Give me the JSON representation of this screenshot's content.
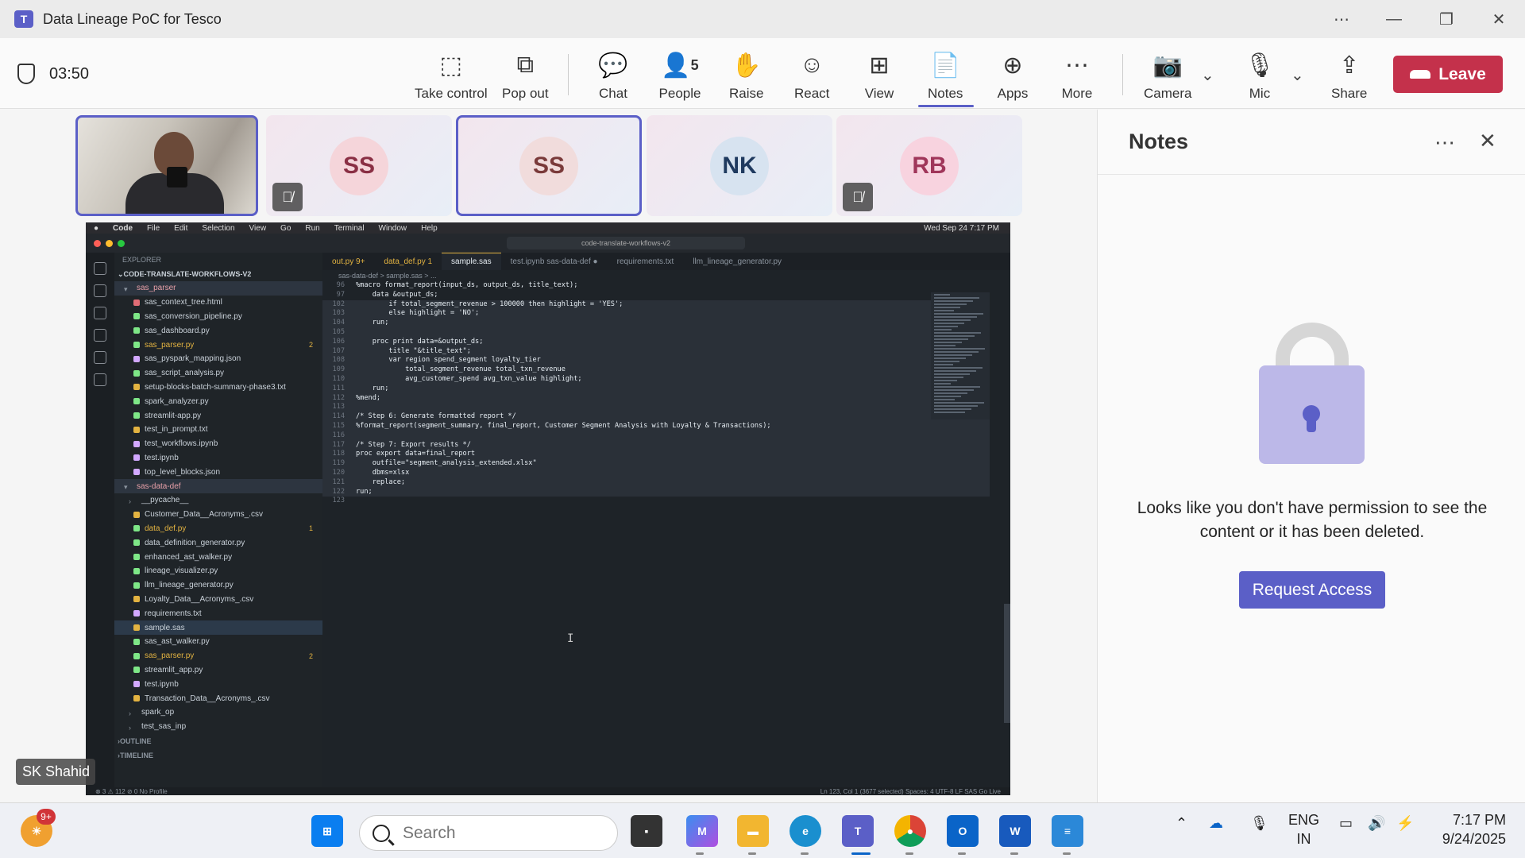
{
  "window": {
    "title": "Data Lineage PoC for Tesco",
    "app_icon": "teams-icon"
  },
  "meeting": {
    "timer": "03:50",
    "toolbar": [
      {
        "label": "Take control",
        "icon": "take-control-icon"
      },
      {
        "label": "Pop out",
        "icon": "pop-out-icon"
      },
      {
        "label": "Chat",
        "icon": "chat-icon"
      },
      {
        "label": "People",
        "icon": "people-icon",
        "count": "5"
      },
      {
        "label": "Raise",
        "icon": "raise-hand-icon"
      },
      {
        "label": "React",
        "icon": "react-icon"
      },
      {
        "label": "View",
        "icon": "view-icon"
      },
      {
        "label": "Notes",
        "icon": "notes-icon",
        "active": true
      },
      {
        "label": "Apps",
        "icon": "apps-icon"
      },
      {
        "label": "More",
        "icon": "more-icon"
      },
      {
        "label": "Camera",
        "icon": "camera-off-icon"
      },
      {
        "label": "Mic",
        "icon": "mic-off-icon"
      },
      {
        "label": "Share",
        "icon": "share-icon"
      }
    ],
    "leave_label": "Leave",
    "participants": [
      {
        "type": "video",
        "active": true
      },
      {
        "initials": "SS",
        "muted": true,
        "color": "#f5d5da",
        "text": "#8a2f44"
      },
      {
        "initials": "SS",
        "muted": false,
        "active": true,
        "color": "#f1dcdc",
        "text": "#7a3a3a"
      },
      {
        "initials": "NK",
        "muted": false,
        "color": "#d7e3f0",
        "text": "#1f3a5f"
      },
      {
        "initials": "RB",
        "muted": true,
        "color": "#f8d3df",
        "text": "#a0365a"
      }
    ],
    "presenter_name": "SK Shahid"
  },
  "screen": {
    "menubar": {
      "items": [
        "Code",
        "File",
        "Edit",
        "Selection",
        "View",
        "Go",
        "Run",
        "Terminal",
        "Window",
        "Help"
      ],
      "clock": "Wed Sep 24  7:17 PM"
    },
    "search": "code-translate-workflows-v2",
    "explorer": {
      "header": "EXPLORER",
      "root": "CODE-TRANSLATE-WORKFLOWS-V2",
      "files": [
        {
          "name": "sas_parser",
          "kind": "folder-open",
          "color": "#e8a0a8"
        },
        {
          "name": "sas_context_tree.html",
          "color": "#e06c75"
        },
        {
          "name": "sas_conversion_pipeline.py",
          "color": "#7ee787"
        },
        {
          "name": "sas_dashboard.py",
          "color": "#7ee787"
        },
        {
          "name": "sas_parser.py",
          "color": "#7ee787",
          "mod": true,
          "badge": "2"
        },
        {
          "name": "sas_pyspark_mapping.json",
          "color": "#d2a8ff"
        },
        {
          "name": "sas_script_analysis.py",
          "color": "#7ee787"
        },
        {
          "name": "setup-blocks-batch-summary-phase3.txt",
          "color": "#e3b341"
        },
        {
          "name": "spark_analyzer.py",
          "color": "#7ee787"
        },
        {
          "name": "streamlit-app.py",
          "color": "#7ee787"
        },
        {
          "name": "test_in_prompt.txt",
          "color": "#e3b341"
        },
        {
          "name": "test_workflows.ipynb",
          "color": "#d2a8ff"
        },
        {
          "name": "test.ipynb",
          "color": "#d2a8ff"
        },
        {
          "name": "top_level_blocks.json",
          "color": "#d2a8ff"
        },
        {
          "name": "sas-data-def",
          "kind": "folder-open",
          "color": "#e8a0a8"
        },
        {
          "name": "__pycache__",
          "kind": "subfolder",
          "color": "#8b949e"
        },
        {
          "name": "Customer_Data__Acronyms_.csv",
          "color": "#e3b341"
        },
        {
          "name": "data_def.py",
          "color": "#7ee787",
          "mod": true,
          "badge": "1"
        },
        {
          "name": "data_definition_generator.py",
          "color": "#7ee787"
        },
        {
          "name": "enhanced_ast_walker.py",
          "color": "#7ee787"
        },
        {
          "name": "lineage_visualizer.py",
          "color": "#7ee787"
        },
        {
          "name": "llm_lineage_generator.py",
          "color": "#7ee787"
        },
        {
          "name": "Loyalty_Data__Acronyms_.csv",
          "color": "#e3b341"
        },
        {
          "name": "requirements.txt",
          "color": "#d2a8ff"
        },
        {
          "name": "sample.sas",
          "color": "#e3b341",
          "sel": true
        },
        {
          "name": "sas_ast_walker.py",
          "color": "#7ee787"
        },
        {
          "name": "sas_parser.py",
          "color": "#7ee787",
          "mod": true,
          "badge": "2"
        },
        {
          "name": "streamlit_app.py",
          "color": "#7ee787"
        },
        {
          "name": "test.ipynb",
          "color": "#d2a8ff"
        },
        {
          "name": "Transaction_Data__Acronyms_.csv",
          "color": "#e3b341"
        },
        {
          "name": "spark_op",
          "kind": "subfolder",
          "color": "#8b949e"
        },
        {
          "name": "test_sas_inp",
          "kind": "subfolder",
          "color": "#8b949e"
        }
      ],
      "outline": "OUTLINE",
      "timeline": "TIMELINE"
    },
    "tabs": [
      {
        "label": "out.py 9+",
        "mod": true
      },
      {
        "label": "data_def.py 1",
        "mod": true
      },
      {
        "label": "sample.sas",
        "active": true
      },
      {
        "label": "test.ipynb  sas-data-def ●"
      },
      {
        "label": "requirements.txt"
      },
      {
        "label": "llm_lineage_generator.py"
      }
    ],
    "breadcrumb": "sas-data-def  >  sample.sas  >  ...",
    "code": [
      {
        "n": "96",
        "t": "%macro format_report(input_ds, output_ds, title_text);"
      },
      {
        "n": "97",
        "t": "    data &output_ds;"
      },
      {
        "n": "102",
        "t": "        if total_segment_revenue > 100000 then highlight = 'YES';"
      },
      {
        "n": "103",
        "t": "        else highlight = 'NO';"
      },
      {
        "n": "104",
        "t": "    run;"
      },
      {
        "n": "105",
        "t": ""
      },
      {
        "n": "106",
        "t": "    proc print data=&output_ds;"
      },
      {
        "n": "107",
        "t": "        title \"&title_text\";"
      },
      {
        "n": "108",
        "t": "        var region spend_segment loyalty_tier"
      },
      {
        "n": "109",
        "t": "            total_segment_revenue total_txn_revenue"
      },
      {
        "n": "110",
        "t": "            avg_customer_spend avg_txn_value highlight;"
      },
      {
        "n": "111",
        "t": "    run;"
      },
      {
        "n": "112",
        "t": "%mend;"
      },
      {
        "n": "113",
        "t": ""
      },
      {
        "n": "114",
        "t": "/* Step 6: Generate formatted report */"
      },
      {
        "n": "115",
        "t": "%format_report(segment_summary, final_report, Customer Segment Analysis with Loyalty & Transactions);"
      },
      {
        "n": "116",
        "t": ""
      },
      {
        "n": "117",
        "t": "/* Step 7: Export results */"
      },
      {
        "n": "118",
        "t": "proc export data=final_report"
      },
      {
        "n": "119",
        "t": "    outfile=\"segment_analysis_extended.xlsx\""
      },
      {
        "n": "120",
        "t": "    dbms=xlsx"
      },
      {
        "n": "121",
        "t": "    replace;"
      },
      {
        "n": "122",
        "t": "run;"
      },
      {
        "n": "123",
        "t": ""
      }
    ],
    "status_left": "⊗ 3 ⚠ 112   ⊘ 0   No Profile",
    "status_right": "Ln 123, Col 1 (3677 selected)   Spaces: 4   UTF-8   LF   SAS   Go Live"
  },
  "notes": {
    "title": "Notes",
    "message": "Looks like you don't have permission to see the content or it has been deleted.",
    "request_label": "Request Access"
  },
  "taskbar": {
    "search_placeholder": "Search",
    "notif_badge": "9+",
    "lang": "ENG",
    "region": "IN",
    "time": "7:17 PM",
    "date": "9/24/2025"
  }
}
